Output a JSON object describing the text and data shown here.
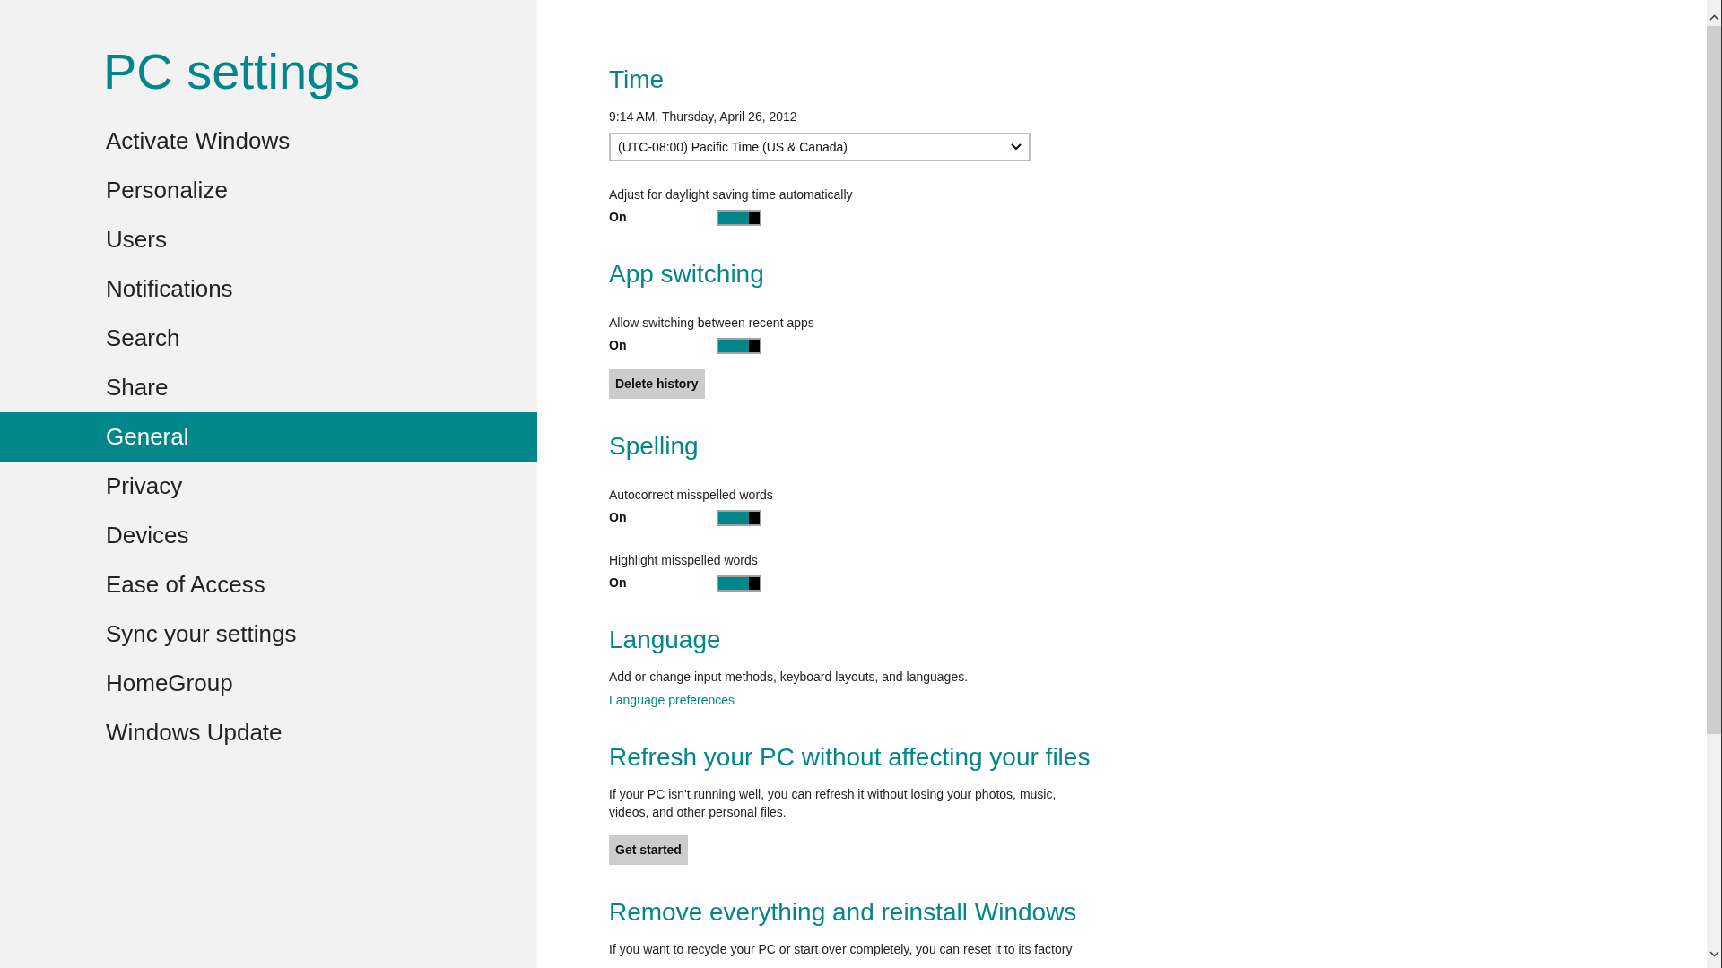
{
  "title": "PC settings",
  "nav": [
    {
      "label": "Activate Windows",
      "selected": false
    },
    {
      "label": "Personalize",
      "selected": false
    },
    {
      "label": "Users",
      "selected": false
    },
    {
      "label": "Notifications",
      "selected": false
    },
    {
      "label": "Search",
      "selected": false
    },
    {
      "label": "Share",
      "selected": false
    },
    {
      "label": "General",
      "selected": true
    },
    {
      "label": "Privacy",
      "selected": false
    },
    {
      "label": "Devices",
      "selected": false
    },
    {
      "label": "Ease of Access",
      "selected": false
    },
    {
      "label": "Sync your settings",
      "selected": false
    },
    {
      "label": "HomeGroup",
      "selected": false
    },
    {
      "label": "Windows Update",
      "selected": false
    }
  ],
  "sections": [
    {
      "heading": "Time",
      "items": [
        {
          "kind": "text",
          "text": "9:14 AM, Thursday, April 26, 2012"
        },
        {
          "kind": "dropdown",
          "value": "(UTC-08:00) Pacific Time (US & Canada)"
        },
        {
          "kind": "toggle",
          "label": "Adjust for daylight saving time automatically",
          "state": "On",
          "on": true
        }
      ]
    },
    {
      "heading": "App switching",
      "items": [
        {
          "kind": "toggle",
          "label": "Allow switching between recent apps",
          "state": "On",
          "on": true
        },
        {
          "kind": "button",
          "label": "Delete history"
        }
      ]
    },
    {
      "heading": "Spelling",
      "items": [
        {
          "kind": "toggle",
          "label": "Autocorrect misspelled words",
          "state": "On",
          "on": true
        },
        {
          "kind": "toggle",
          "label": "Highlight misspelled words",
          "state": "On",
          "on": true
        }
      ]
    },
    {
      "heading": "Language",
      "items": [
        {
          "kind": "text",
          "text": "Add or change input methods, keyboard layouts, and languages."
        },
        {
          "kind": "link",
          "label": "Language preferences"
        }
      ]
    },
    {
      "heading": "Refresh your PC without affecting your files",
      "items": [
        {
          "kind": "text",
          "text": "If your PC isn't running well, you can refresh it without losing your photos, music, videos, and other personal files."
        },
        {
          "kind": "button",
          "label": "Get started"
        }
      ]
    },
    {
      "heading": "Remove everything and reinstall Windows",
      "items": [
        {
          "kind": "text",
          "text": "If you want to recycle your PC or start over completely, you can reset it to its factory"
        }
      ]
    }
  ]
}
